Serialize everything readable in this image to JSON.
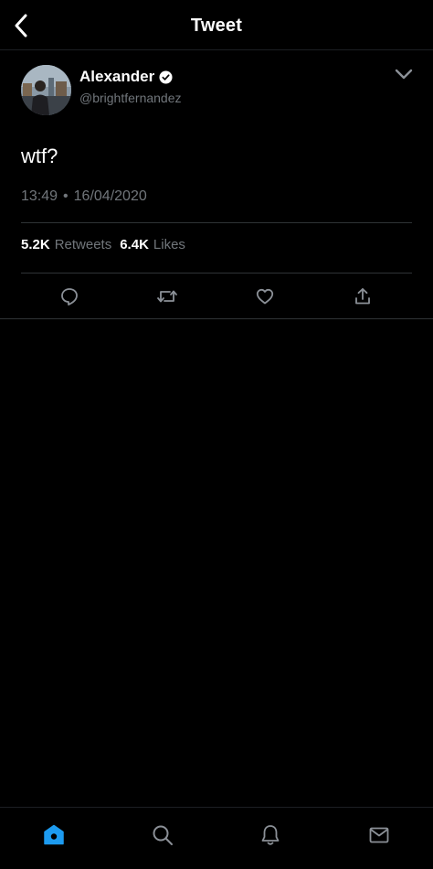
{
  "header": {
    "title": "Tweet",
    "back_icon": "chevron-left-icon"
  },
  "tweet": {
    "author_name": "Alexander",
    "author_handle": "@brightfernandez",
    "verified": true,
    "text": "wtf?",
    "time": "13:49",
    "separator": "•",
    "date": "16/04/2020",
    "retweets_count": "5.2K",
    "retweets_label": "Retweets",
    "likes_count": "6.4K",
    "likes_label": "Likes",
    "more_icon": "chevron-down-icon"
  },
  "actions": [
    "reply-icon",
    "retweet-icon",
    "like-icon",
    "share-icon"
  ],
  "bottom_nav": [
    "home-icon",
    "search-icon",
    "notifications-icon",
    "messages-icon"
  ],
  "colors": {
    "background": "#000000",
    "text": "#ffffff",
    "secondary_text": "#71767b",
    "divider": "#2f3336",
    "accent": "#1d9bf0"
  }
}
